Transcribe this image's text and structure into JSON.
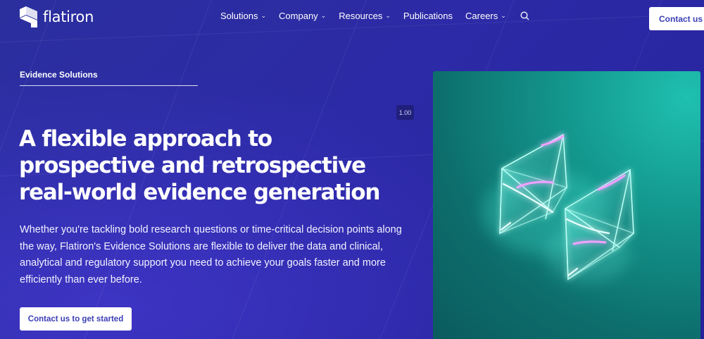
{
  "header": {
    "logo_text": "flatiron",
    "nav": [
      {
        "label": "Solutions",
        "has_dropdown": true
      },
      {
        "label": "Company",
        "has_dropdown": true
      },
      {
        "label": "Resources",
        "has_dropdown": true
      },
      {
        "label": "Publications",
        "has_dropdown": false
      },
      {
        "label": "Careers",
        "has_dropdown": true
      }
    ],
    "search_icon": "search-icon",
    "contact_label": "Contact us"
  },
  "hero": {
    "eyebrow": "Evidence Solutions",
    "badge": "1.00",
    "headline": "A flexible approach to prospective and retrospective real-world evidence generation",
    "body": "Whether you're tackling bold research questions or time-critical decision points along the way, Flatiron's Evidence Solutions are flexible to deliver the data and clinical, analytical and regulatory support you need to achieve your goals faster and more efficiently than ever before.",
    "cta_label": "Contact us to get started",
    "image_icon": "glowing-crystal-logo-icon"
  },
  "colors": {
    "background": "#2a2aa0",
    "button_text": "#3b3fb5",
    "image_teal": "#13968c"
  }
}
